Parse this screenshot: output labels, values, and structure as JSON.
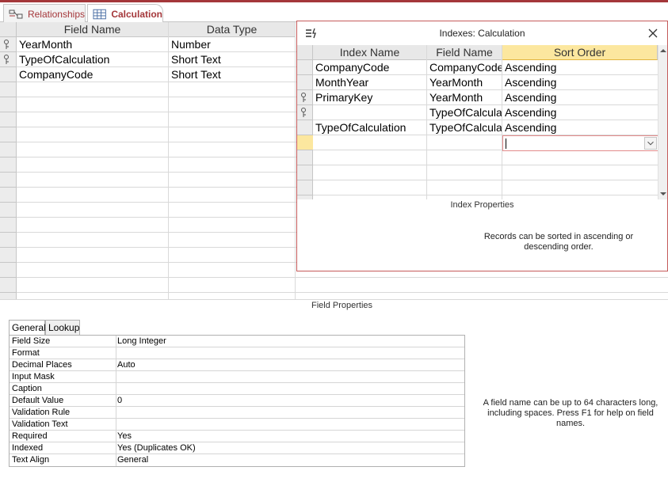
{
  "tabs": [
    {
      "label": "Relationships",
      "icon": "relationships-icon"
    },
    {
      "label": "Calculation",
      "icon": "table-icon"
    }
  ],
  "design_grid": {
    "columns": [
      "Field Name",
      "Data Type"
    ],
    "rows": [
      {
        "field": "YearMonth",
        "type": "Number",
        "key": true
      },
      {
        "field": "TypeOfCalculation",
        "type": "Short Text",
        "key": true
      },
      {
        "field": "CompanyCode",
        "type": "Short Text",
        "key": false
      }
    ]
  },
  "field_properties": {
    "title": "Field Properties",
    "tabs": [
      "General",
      "Lookup"
    ],
    "rows": [
      {
        "name": "Field Size",
        "value": "Long Integer"
      },
      {
        "name": "Format",
        "value": ""
      },
      {
        "name": "Decimal Places",
        "value": "Auto"
      },
      {
        "name": "Input Mask",
        "value": ""
      },
      {
        "name": "Caption",
        "value": ""
      },
      {
        "name": "Default Value",
        "value": "0"
      },
      {
        "name": "Validation Rule",
        "value": ""
      },
      {
        "name": "Validation Text",
        "value": ""
      },
      {
        "name": "Required",
        "value": "Yes"
      },
      {
        "name": "Indexed",
        "value": "Yes (Duplicates OK)"
      },
      {
        "name": "Text Align",
        "value": "General"
      }
    ],
    "help": "A field name can be up to 64 characters long, including spaces. Press F1 for help on field names."
  },
  "indexes_dialog": {
    "title": "Indexes: Calculation",
    "columns": [
      "Index Name",
      "Field Name",
      "Sort Order"
    ],
    "rows": [
      {
        "index": "CompanyCode",
        "field": "CompanyCode",
        "sort": "Ascending",
        "key": false
      },
      {
        "index": "MonthYear",
        "field": "YearMonth",
        "sort": "Ascending",
        "key": false
      },
      {
        "index": "PrimaryKey",
        "field": "YearMonth",
        "sort": "Ascending",
        "key": true
      },
      {
        "index": "",
        "field": "TypeOfCalculat",
        "sort": "Ascending",
        "key": true
      },
      {
        "index": "TypeOfCalculation",
        "field": "TypeOfCalculat",
        "sort": "Ascending",
        "key": false
      }
    ],
    "properties_title": "Index Properties",
    "properties_help": "Records can be sorted in ascending or descending order."
  },
  "colors": {
    "accent": "#a4373a",
    "header_highlight": "#fce79f"
  }
}
